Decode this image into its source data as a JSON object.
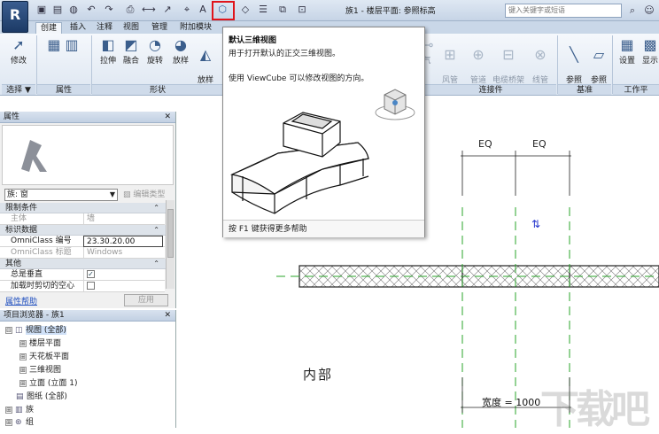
{
  "title_bar": {
    "window_title": "族1 - 楼层平面: 参照标高",
    "search_placeholder": "键入关键字或短语",
    "app_letter": "R",
    "text_tool": "A"
  },
  "tabs": [
    {
      "label": "创建",
      "active": true
    },
    {
      "label": "插入",
      "active": false
    },
    {
      "label": "注释",
      "active": false
    },
    {
      "label": "视图",
      "active": false
    },
    {
      "label": "管理",
      "active": false
    },
    {
      "label": "附加模块",
      "active": false
    }
  ],
  "ribbon": {
    "modify": "修改",
    "select_group": "选择 ▼",
    "properties_group": "属性",
    "form_group": "形状",
    "connector_group": "连接件",
    "datum_group": "基准",
    "workplane_group": "工作平",
    "form_buttons": [
      "拉伸",
      "融合",
      "旋转",
      "放样",
      "放样\n融合"
    ],
    "connector_buttons": [
      "气",
      "风管\n连接件",
      "管道\n连接件",
      "电缆桥架\n连接件",
      "线管\n连接件"
    ],
    "datum_buttons": [
      "参照\n线",
      "参照\n平面"
    ],
    "workplane_buttons": [
      "设置",
      "显示"
    ]
  },
  "properties": {
    "title": "属性",
    "type_value": "族: 窗",
    "edit_type": "编辑类型",
    "sections": {
      "constraints": "限制条件",
      "identity": "标识数据",
      "other": "其他"
    },
    "rows": {
      "host_key": "主体",
      "host_val": "墙",
      "omni_num_key": "OmniClass 编号",
      "omni_num_val": "23.30.20.00",
      "omni_title_key": "OmniClass 标题",
      "omni_title_val": "Windows",
      "always_vert_key": "总是垂直",
      "always_vert_val": "✓",
      "cut_key": "加载时剪切的空心",
      "cut_val": ""
    },
    "help_link": "属性帮助",
    "apply": "应用"
  },
  "browser": {
    "title": "项目浏览器 - 族1",
    "items": [
      {
        "label": "视图 (全部)",
        "toggle": "⊟"
      },
      {
        "label": "楼层平面",
        "toggle": "⊞"
      },
      {
        "label": "天花板平面",
        "toggle": "⊞"
      },
      {
        "label": "三维视图",
        "toggle": "⊞"
      },
      {
        "label": "立面 (立面 1)",
        "toggle": "⊞"
      },
      {
        "label": "图纸 (全部)",
        "toggle": ""
      },
      {
        "label": "族",
        "toggle": "⊞"
      },
      {
        "label": "组",
        "toggle": "⊞"
      }
    ]
  },
  "canvas": {
    "eq_left": "EQ",
    "eq_right": "EQ",
    "room_label": "内部",
    "width_label": "宽度 = 1000",
    "flip_symbol": "⇅",
    "watermark": "下载吧"
  },
  "tooltip": {
    "title": "默认三维视图",
    "description": "用于打开默认的正交三维视图。",
    "detail": "使用 ViewCube 可以修改视图的方向。",
    "footer": "按 F1 键获得更多帮助"
  },
  "colors": {
    "accent": "#3b5e8c",
    "highlight": "#e0141b",
    "ref_plane": "#2aa42a"
  }
}
